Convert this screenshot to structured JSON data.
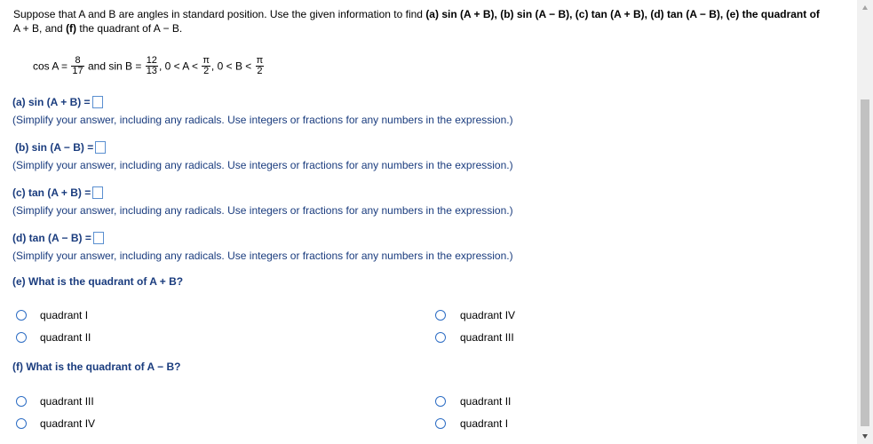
{
  "intro": {
    "line1_pre": "Suppose that A and B are angles in standard position. Use the given information to find ",
    "part_a": "(a) sin (A + B),",
    "part_b": "(b) sin (A − B),",
    "part_c": "(c) tan (A + B),",
    "part_d": "(d) tan (A − B),",
    "part_e": "(e) the quadrant of",
    "line2": "A + B, and",
    "part_f": "(f)",
    "line2_end": "the quadrant of A − B."
  },
  "given": {
    "cos_label": "cos A =",
    "cos_num": "8",
    "cos_den": "17",
    "and_sin": "and sin B =",
    "sin_num": "12",
    "sin_den": "13",
    "range_a": ", 0 < A <",
    "pi": "π",
    "two": "2",
    "range_b": ", 0 < B <"
  },
  "questions": {
    "a_label": "(a) sin (A + B) =",
    "b_label": "(b) sin (A − B) =",
    "c_label": "(c) tan (A + B) =",
    "d_label": "(d) tan (A − B) =",
    "hint": "(Simplify your answer, including any radicals. Use integers or fractions for any numbers in the expression.)",
    "e_label": "(e) What is the quadrant of A + B?",
    "f_label": "(f) What is the quadrant of A − B?"
  },
  "options_e": {
    "left1": "quadrant I",
    "left2": "quadrant II",
    "right1": "quadrant IV",
    "right2": "quadrant III"
  },
  "options_f": {
    "left1": "quadrant III",
    "left2": "quadrant IV",
    "right1": "quadrant II",
    "right2": "quadrant I"
  },
  "colors": {
    "accent": "#2d6dc4",
    "text_blue": "#1a3c7e",
    "scroll_thumb": "#c1c1c1"
  }
}
